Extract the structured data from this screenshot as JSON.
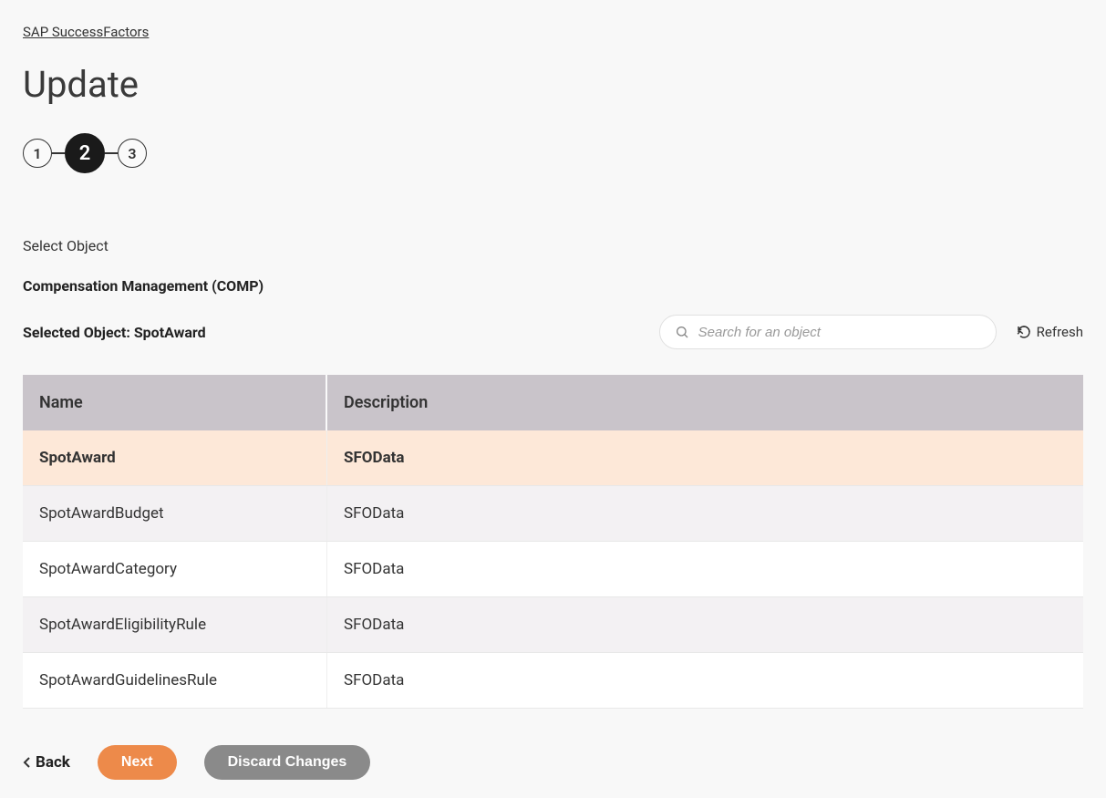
{
  "breadcrumb": {
    "link": "SAP SuccessFactors"
  },
  "page_title": "Update",
  "stepper": {
    "steps": [
      "1",
      "2",
      "3"
    ],
    "active_index": 1
  },
  "section": {
    "label": "Select Object",
    "category": "Compensation Management (COMP)",
    "selected_object_label": "Selected Object: SpotAward"
  },
  "search": {
    "placeholder": "Search for an object"
  },
  "refresh_label": "Refresh",
  "table": {
    "columns": {
      "name": "Name",
      "description": "Description"
    },
    "rows": [
      {
        "name": "SpotAward",
        "description": "SFOData",
        "selected": true
      },
      {
        "name": "SpotAwardBudget",
        "description": "SFOData",
        "selected": false
      },
      {
        "name": "SpotAwardCategory",
        "description": "SFOData",
        "selected": false
      },
      {
        "name": "SpotAwardEligibilityRule",
        "description": "SFOData",
        "selected": false
      },
      {
        "name": "SpotAwardGuidelinesRule",
        "description": "SFOData",
        "selected": false
      }
    ]
  },
  "footer": {
    "back": "Back",
    "next": "Next",
    "discard": "Discard Changes"
  }
}
